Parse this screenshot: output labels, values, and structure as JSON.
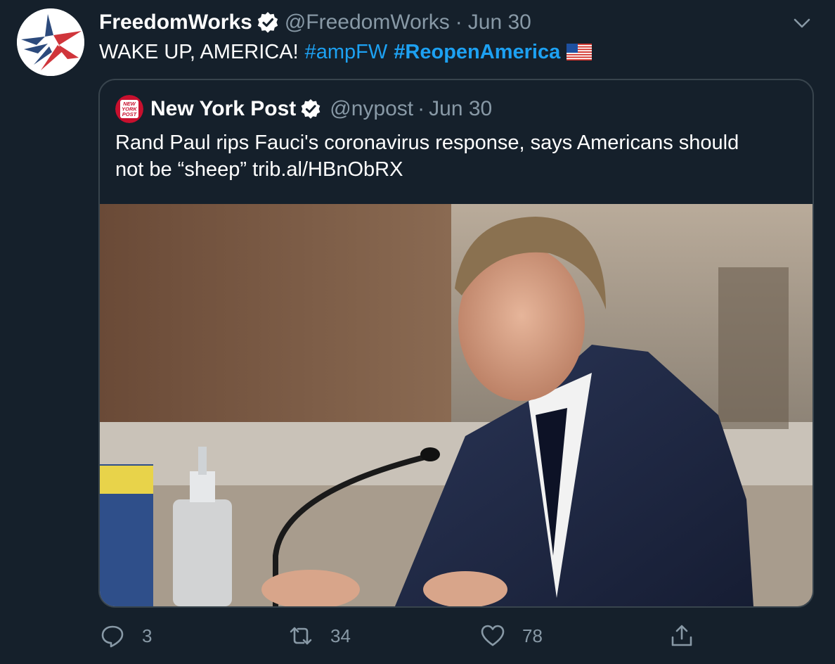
{
  "tweet": {
    "display_name": "FreedomWorks",
    "handle": "@FreedomWorks",
    "separator": "·",
    "date": "Jun 30",
    "text": "WAKE UP, AMERICA!",
    "hashtags": [
      "#ampFW",
      "#ReopenAmerica"
    ],
    "flag_icon": "us-flag-emoji",
    "avatar_icon": "freedomworks-star-logo"
  },
  "quoted_tweet": {
    "display_name": "New York Post",
    "handle": "@nypost",
    "separator": "·",
    "date": "Jun 30",
    "text_line1": "Rand Paul rips Fauci's coronavirus response, says Americans should",
    "text_line2": "not be “sheep” trib.al/HBnObRX",
    "avatar_logo_text": [
      "NEW",
      "YORK",
      "POST"
    ],
    "image_description_icon": "news-photo"
  },
  "actions": {
    "reply_count": "3",
    "retweet_count": "34",
    "like_count": "78"
  },
  "colors": {
    "background": "#15202b",
    "secondary_text": "#8899a6",
    "link": "#1da1f2",
    "border": "#38444d",
    "nypost_red": "#c8102e"
  }
}
